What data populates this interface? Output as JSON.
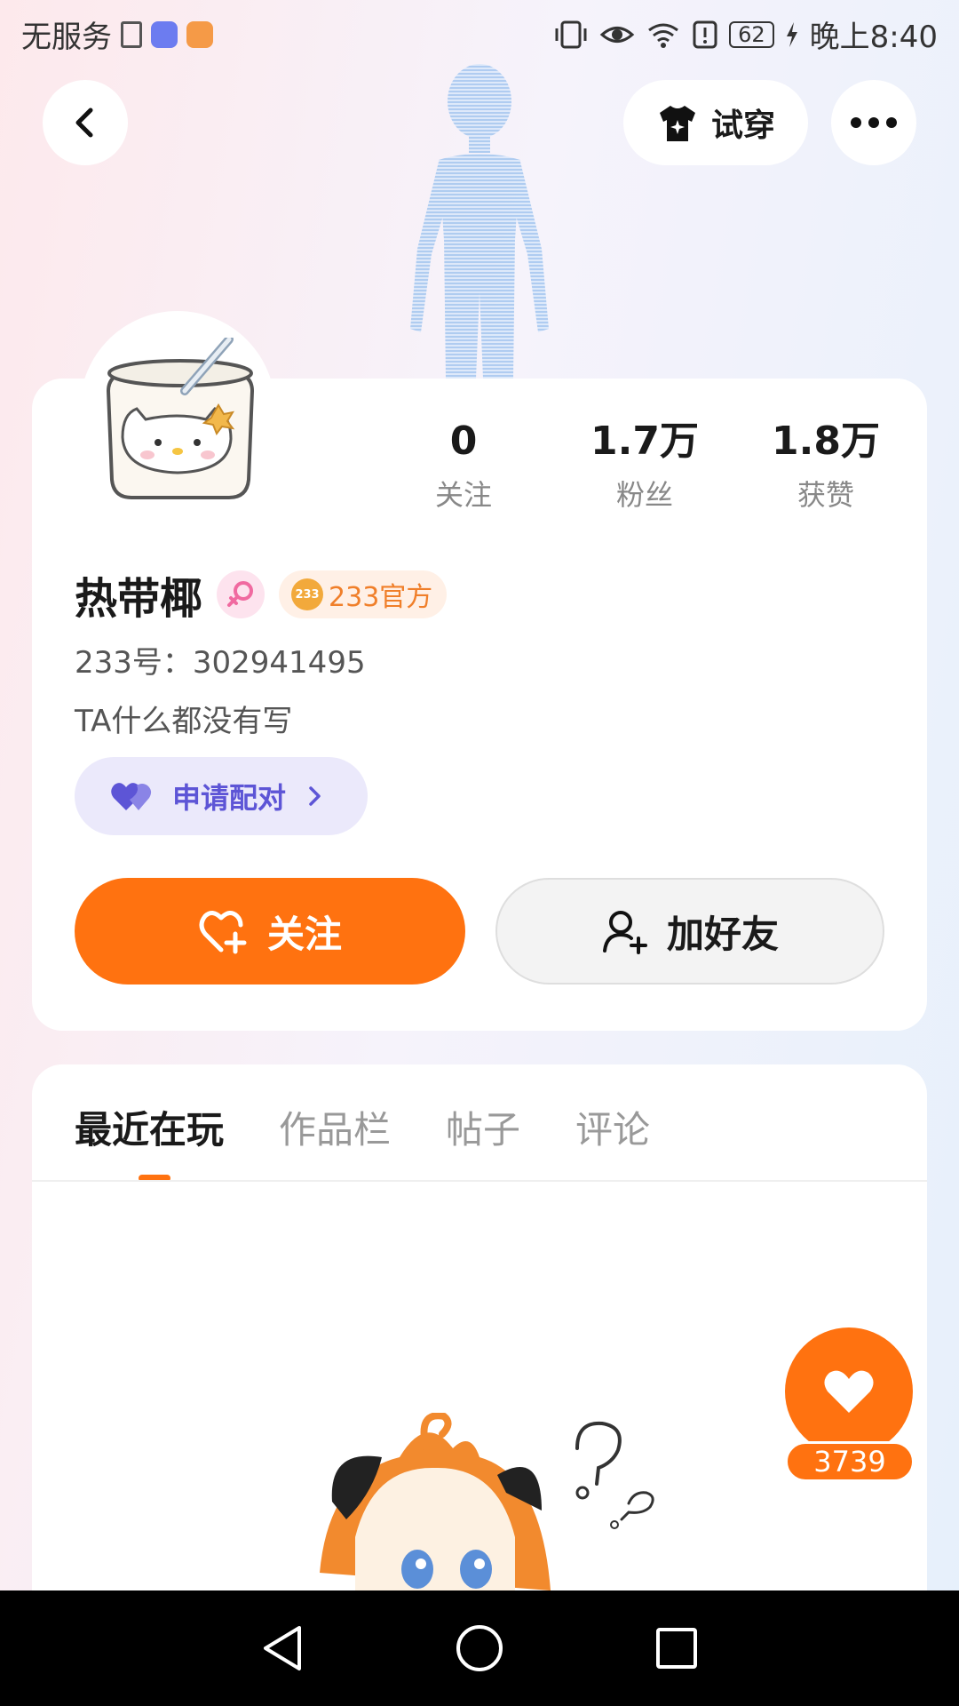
{
  "status_bar": {
    "carrier": "无服务",
    "battery": "62",
    "time": "晚上8:40"
  },
  "header": {
    "tryon_label": "试穿"
  },
  "profile": {
    "name": "热带椰",
    "official_badge": "233官方",
    "official_logo_text": "233",
    "user_id": "233号：302941495",
    "bio": "TA什么都没有写",
    "pair_button": "申请配对",
    "stats": [
      {
        "value": "0",
        "label": "关注"
      },
      {
        "value": "1.7万",
        "label": "粉丝"
      },
      {
        "value": "1.8万",
        "label": "获赞"
      }
    ],
    "follow_button": "关注",
    "add_friend_button": "加好友"
  },
  "tabs": [
    "最近在玩",
    "作品栏",
    "帖子",
    "评论"
  ],
  "active_tab": 0,
  "like": {
    "count": "3739"
  },
  "colors": {
    "accent": "#ff7210",
    "pair": "#5d55d6",
    "official": "#f07f2a"
  },
  "icons": {
    "back": "chevron-left-icon",
    "tryon": "tshirt-icon",
    "more": "more-dots-icon",
    "gender": "female-icon",
    "pair": "double-heart-icon",
    "follow": "heart-plus-icon",
    "friend": "add-user-icon",
    "like": "heart-icon"
  }
}
